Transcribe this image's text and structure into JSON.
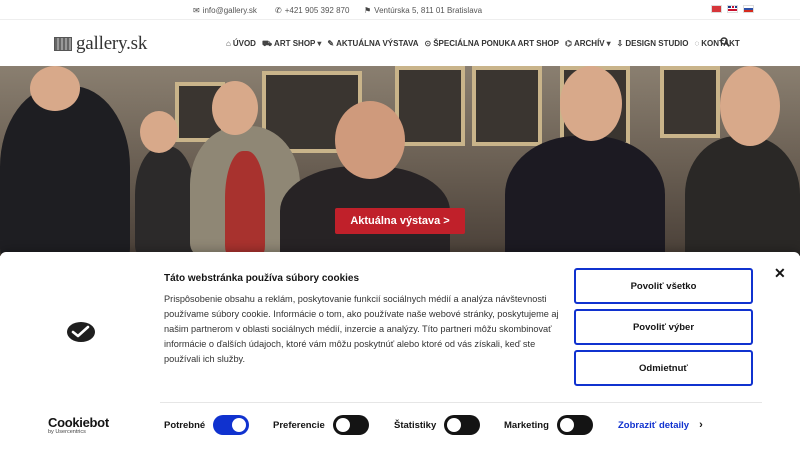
{
  "topbar": {
    "email": "info@gallery.sk",
    "phone": "+421 905 392 870",
    "address": "Ventúrska 5, 811 01 Bratislava",
    "languages": [
      "CZ",
      "EN",
      "SK"
    ]
  },
  "navbar": {
    "logo_text": "gallery.sk",
    "items": [
      {
        "label": "ÚVOD",
        "icon": "home-icon"
      },
      {
        "label": "ART SHOP",
        "icon": "cart-icon",
        "dropdown": true
      },
      {
        "label": "AKTUÁLNA VÝSTAVA",
        "icon": "brush-icon"
      },
      {
        "label": "ŠPECIÁLNA PONUKA ART SHOP",
        "icon": "play-circle-icon"
      },
      {
        "label": "ARCHÍV",
        "icon": "bank-icon",
        "dropdown": true
      },
      {
        "label": "DESIGN STUDIO",
        "icon": "download-icon"
      },
      {
        "label": "KONTAKT",
        "icon": "chat-icon"
      }
    ],
    "search_icon": "search-icon"
  },
  "hero": {
    "cta_label": "Aktuálna výstava >"
  },
  "cookie": {
    "title": "Táto webstránka používa súbory cookies",
    "text": "Prispôsobenie obsahu a reklám, poskytovanie funkcií sociálnych médií a analýza návštevnosti používame súbory cookie. Informácie o tom, ako používate naše webové stránky, poskytujeme aj našim partnerom v oblasti sociálnych médií, inzercie a analýzy. Títo partneri môžu skombinovať informácie o ďalších údajoch, ktoré vám môžu poskytnúť alebo ktoré od vás získali, keď ste používali ich služby.",
    "buttons": {
      "allow_all": "Povoliť všetko",
      "allow_selection": "Povoliť výber",
      "deny": "Odmietnuť"
    },
    "brand": {
      "name": "Cookiebot",
      "by": "by Usercentrics"
    },
    "toggles": [
      {
        "label": "Potrebné",
        "on": true
      },
      {
        "label": "Preferencie",
        "on": false
      },
      {
        "label": "Štatistiky",
        "on": false
      },
      {
        "label": "Marketing",
        "on": false
      }
    ],
    "details_link": "Zobraziť detaily",
    "accent_color": "#1032cf"
  }
}
